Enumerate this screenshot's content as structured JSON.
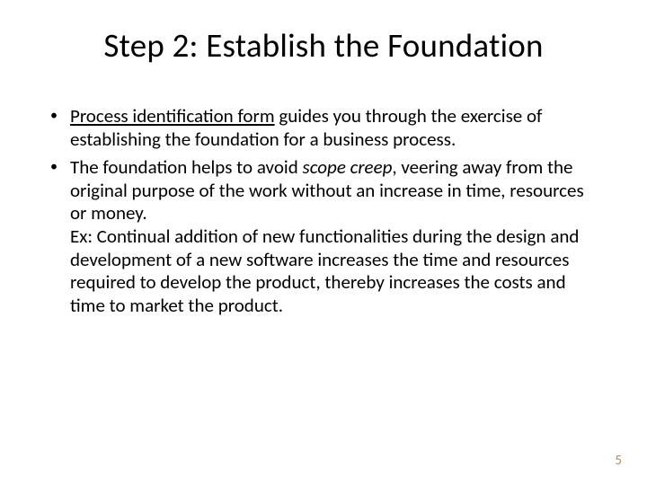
{
  "title": "Step 2: Establish the Foundation",
  "bullets": [
    {
      "underlined": "Process identification form",
      "rest": " guides you through the exercise of establishing the foundation for a business process."
    },
    {
      "pre": "The foundation helps to avoid ",
      "italic": "scope creep",
      "post": ", veering away from the original purpose of the work without an increase in time, resources or money.",
      "continuation": "Ex: Continual addition of new functionalities during the design and development of a new software increases the time and resources required to develop the product, thereby increases the costs and time to market the product."
    }
  ],
  "page_number": "5"
}
